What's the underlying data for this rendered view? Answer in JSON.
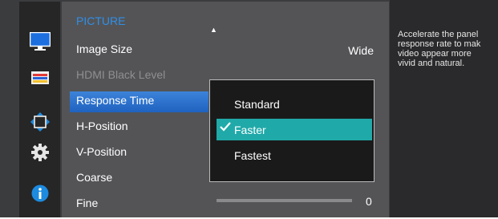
{
  "menu": {
    "title": "PICTURE",
    "items": [
      {
        "label": "Image Size",
        "value": "Wide"
      },
      {
        "label": "HDMI Black Level"
      },
      {
        "label": "Response Time"
      },
      {
        "label": "H-Position"
      },
      {
        "label": "V-Position"
      },
      {
        "label": "Coarse"
      },
      {
        "label": "Fine",
        "value": "0"
      }
    ]
  },
  "popup": {
    "options": [
      "Standard",
      "Faster",
      "Fastest"
    ],
    "selected": "Faster"
  },
  "help": {
    "text": "Accelerate the panel\nresponse rate to mak\nvideo appear more\nvivid and natural."
  },
  "sidebar": [
    "monitor-icon",
    "color-bars-icon",
    "position-arrows-icon",
    "gear-icon",
    "info-icon"
  ],
  "colors": {
    "title": "#2f8fe6",
    "selection": "#2a73cf",
    "highlight": "#20a9a9"
  }
}
